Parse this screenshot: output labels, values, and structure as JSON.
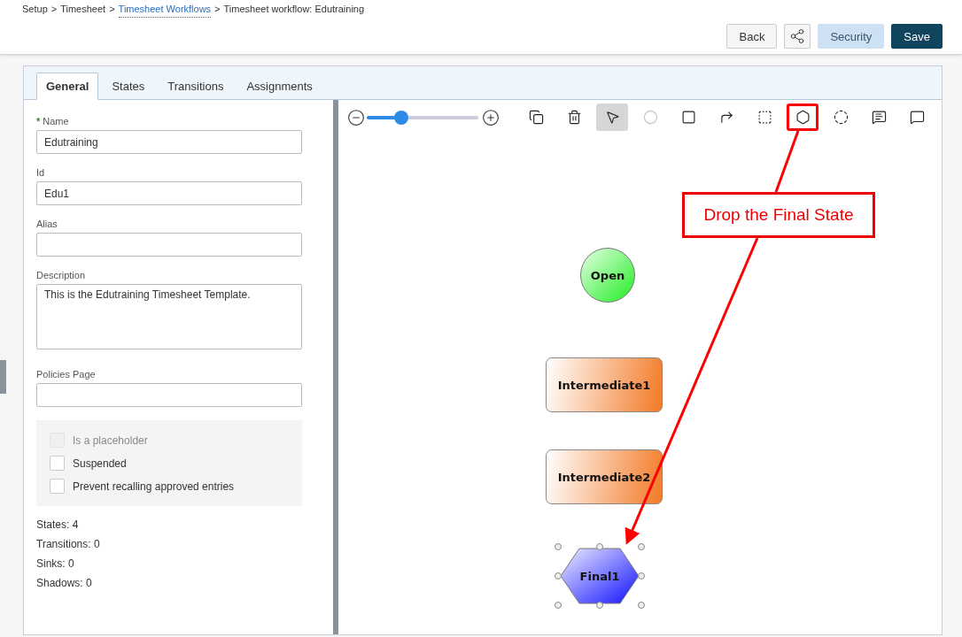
{
  "breadcrumb": [
    {
      "label": "Setup",
      "link": false
    },
    {
      "label": "Timesheet",
      "link": false
    },
    {
      "label": "Timesheet Workflows",
      "link": true
    },
    {
      "label": "Timesheet workflow: Edutraining",
      "link": false
    }
  ],
  "breadcrumb_separator": ">",
  "header_buttons": [
    {
      "label": "Back",
      "kind": "default"
    },
    {
      "kind": "share"
    },
    {
      "label": "Security",
      "kind": "secondary"
    },
    {
      "label": "Save",
      "kind": "primary"
    }
  ],
  "tabs": [
    {
      "label": "General",
      "selected": true
    },
    {
      "label": "States",
      "selected": false
    },
    {
      "label": "Transitions",
      "selected": false
    },
    {
      "label": "Assignments",
      "selected": false
    }
  ],
  "form": {
    "fields": [
      {
        "label": "Name",
        "required_mark": "*",
        "value": "Edutraining",
        "kind": "input"
      },
      {
        "label": "Id",
        "value": "Edu1",
        "kind": "input"
      },
      {
        "label": "Alias",
        "kind": "input"
      },
      {
        "label": "Description",
        "value": "This is the Edutraining Timesheet Template.",
        "kind": "textarea"
      },
      {
        "label": "Policies Page",
        "kind": "input"
      }
    ],
    "checkboxes": [
      {
        "label": "Is a placeholder",
        "checked": false,
        "disabled": true
      },
      {
        "label": "Suspended",
        "checked": false,
        "disabled": false
      },
      {
        "label": "Prevent recalling approved entries",
        "checked": false,
        "disabled": false
      }
    ],
    "stats": [
      "States: 4",
      "Transitions: 0",
      "Sinks: 0",
      "Shadows: 0"
    ]
  },
  "zoom": {
    "level": 0.31
  },
  "tools": [
    {
      "kind": "copy",
      "selected": false,
      "disabled": false,
      "highlighted": false
    },
    {
      "kind": "delete",
      "selected": false,
      "disabled": false,
      "highlighted": false
    },
    {
      "kind": "pointer",
      "selected": true,
      "disabled": false,
      "highlighted": false
    },
    {
      "kind": "add-circle",
      "selected": false,
      "disabled": true,
      "highlighted": false
    },
    {
      "kind": "add-rect",
      "selected": false,
      "disabled": false,
      "highlighted": false
    },
    {
      "kind": "transition",
      "selected": false,
      "disabled": false,
      "highlighted": false
    },
    {
      "kind": "add-dashed-rect",
      "selected": false,
      "disabled": false,
      "highlighted": false
    },
    {
      "kind": "add-hexagon",
      "selected": false,
      "disabled": false,
      "highlighted": true
    },
    {
      "kind": "add-dotted-circle",
      "selected": false,
      "disabled": false,
      "highlighted": false
    },
    {
      "kind": "comment",
      "selected": false,
      "disabled": false,
      "highlighted": false
    },
    {
      "kind": "dotted-comment",
      "selected": false,
      "disabled": false,
      "highlighted": false
    }
  ],
  "nodes": [
    {
      "label": "Open",
      "kind": "start",
      "selected": false
    },
    {
      "label": "Intermediate1",
      "kind": "intermediate",
      "selected": false
    },
    {
      "label": "Intermediate2",
      "kind": "intermediate",
      "selected": false
    },
    {
      "label": "Final1",
      "kind": "final",
      "selected": true
    }
  ],
  "annotation": {
    "text": "Drop the Final State"
  }
}
